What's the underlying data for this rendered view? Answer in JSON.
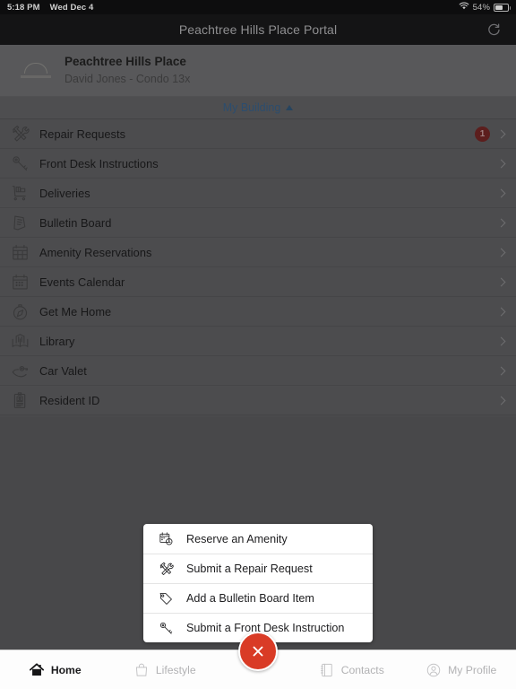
{
  "status_bar": {
    "time": "5:18 PM",
    "date": "Wed Dec 4",
    "battery_percent": "54%",
    "wifi_icon": "wifi-icon",
    "battery_icon": "battery-icon"
  },
  "nav_bar": {
    "title": "Peachtree Hills Place Portal",
    "refresh_icon": "refresh-icon"
  },
  "building_header": {
    "logo_icon": "building-logo-icon",
    "name": "Peachtree Hills Place",
    "resident": "David Jones - Condo 13x"
  },
  "building_selector": {
    "label": "My Building",
    "caret_icon": "caret-up-icon"
  },
  "menu": {
    "items": [
      {
        "label": "Repair Requests",
        "icon": "wrench-screwdriver-icon",
        "badge": "1"
      },
      {
        "label": "Front Desk Instructions",
        "icon": "key-icon",
        "badge": ""
      },
      {
        "label": "Deliveries",
        "icon": "delivery-cart-icon",
        "badge": ""
      },
      {
        "label": "Bulletin Board",
        "icon": "bulletin-note-icon",
        "badge": ""
      },
      {
        "label": "Amenity Reservations",
        "icon": "calendar-grid-icon",
        "badge": ""
      },
      {
        "label": "Events Calendar",
        "icon": "calendar-icon",
        "badge": ""
      },
      {
        "label": "Get Me Home",
        "icon": "compass-icon",
        "badge": ""
      },
      {
        "label": "Library",
        "icon": "open-book-icon",
        "badge": ""
      },
      {
        "label": "Car Valet",
        "icon": "car-key-hand-icon",
        "badge": ""
      },
      {
        "label": "Resident ID",
        "icon": "id-badge-icon",
        "badge": ""
      }
    ]
  },
  "action_popup": {
    "items": [
      {
        "label": "Reserve an Amenity",
        "icon": "calendar-clock-icon"
      },
      {
        "label": "Submit a Repair Request",
        "icon": "wrench-screwdriver-icon"
      },
      {
        "label": "Add a Bulletin Board Item",
        "icon": "tag-icon"
      },
      {
        "label": "Submit a Front Desk Instruction",
        "icon": "key-icon"
      }
    ]
  },
  "tab_bar": {
    "tabs": [
      {
        "label": "Home",
        "icon": "home-icon",
        "active": true
      },
      {
        "label": "Lifestyle",
        "icon": "bag-icon",
        "active": false
      },
      {
        "label": "Contacts",
        "icon": "contacts-icon",
        "active": false
      },
      {
        "label": "My Profile",
        "icon": "person-circle-icon",
        "active": false
      }
    ],
    "fab_icon": "close-icon"
  },
  "colors": {
    "accent_red": "#d93b26",
    "badge_red": "#5c1e1d",
    "link_blue": "#2c4d6e",
    "dim_overlay": "#48484a",
    "navbar_dark": "#141415"
  }
}
